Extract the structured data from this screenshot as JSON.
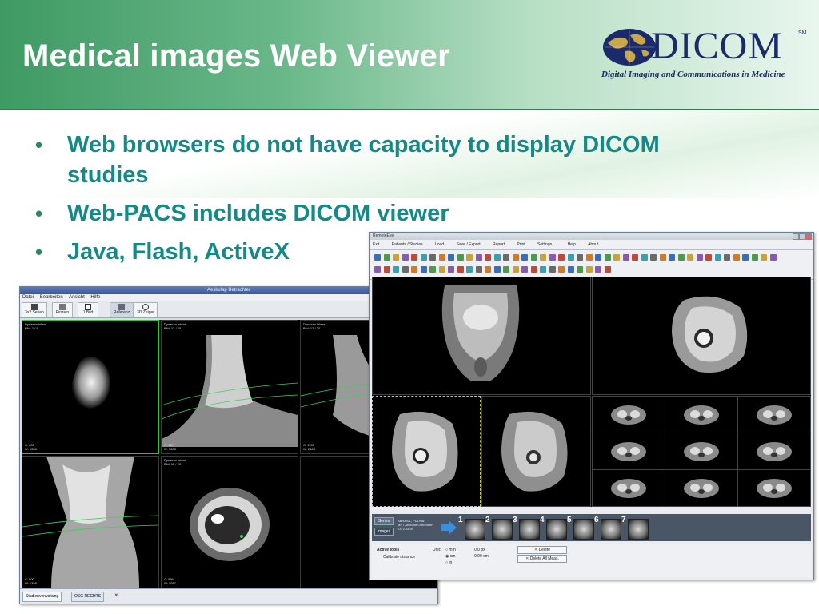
{
  "slide": {
    "title": "Medical images Web Viewer",
    "bullets": [
      "Web browsers do not have capacity to display DICOM studies",
      "Web-PACS includes DICOM viewer",
      "Java, Flash, ActiveX"
    ]
  },
  "logo": {
    "wordmark": "DICOM",
    "mark": "SM",
    "tagline": "Digital Imaging and Communications in Medicine"
  },
  "left_viewer": {
    "window_title": "Aeskulap Betrachter",
    "menu": [
      "Datei",
      "Bearbeiten",
      "Ansicht",
      "Hilfe"
    ],
    "toolbar": [
      {
        "label": "3x2 Serien",
        "icon": "grid-icon"
      },
      {
        "label": "Einzeln",
        "icon": "single-image-icon"
      },
      {
        "label": "1 Bild",
        "icon": "frame-icon"
      },
      {
        "label": "Referenz",
        "icon": "reference-icon"
      },
      {
        "label": "3D Zeiger",
        "icon": "crosshair-icon"
      }
    ],
    "cells": [
      {
        "tl": "Dynasan Intera",
        "tl2": "Bild: 1 / 9",
        "bl": "C: 600",
        "bl2": "W: 1358"
      },
      {
        "tl": "Dynasan Intera",
        "tl2": "Bild: 13 / 20",
        "bl": "C: 960",
        "bl2": "W: 1083"
      },
      {
        "tl": "Dynasan Intera",
        "tl2": "Bild: 12 / 20",
        "bl": "C: 1190",
        "bl2": "W: 2468"
      },
      {
        "tl": "",
        "tl2": "",
        "bl": "C: 600",
        "bl2": "W: 1358"
      },
      {
        "tl": "Dynasan Intera",
        "tl2": "Bild: 15 / 20",
        "bl": "C: 956",
        "bl2": "W: 1087"
      },
      {
        "tl": "",
        "tl2": "",
        "bl": "",
        "bl2": ""
      }
    ],
    "status_tabs": [
      "Studienverwaltung",
      "OSG RECHTS"
    ]
  },
  "right_viewer": {
    "window_title": "RemoteEye",
    "menu": [
      "Exit",
      "Patients / Studies",
      "Load",
      "Save / Export",
      "Report",
      "Print",
      "Settings...",
      "Help",
      "About..."
    ],
    "thumb_side_tabs": [
      "Series",
      "Images"
    ],
    "thumb_info": [
      "ABRASIL, PULSAR",
      "MRT Abdomen Abdomen",
      "2372.05.04"
    ],
    "thumb_numbers": [
      "1",
      "2",
      "3",
      "4",
      "5",
      "6",
      "7"
    ],
    "active_tools_label": "Active tools",
    "calibrate_label": "Calibrate distance",
    "unit_label": "Unit:",
    "units": [
      "mm",
      "cm",
      "in"
    ],
    "values": [
      "0.0 px",
      "0.00 cm"
    ],
    "delete_button": "Delete",
    "delete_all_button": "Delete All Meas."
  },
  "colors": {
    "header_dark": "#3f9a63",
    "bullet_text": "#138a85",
    "logo_blue": "#1b2a6b"
  }
}
